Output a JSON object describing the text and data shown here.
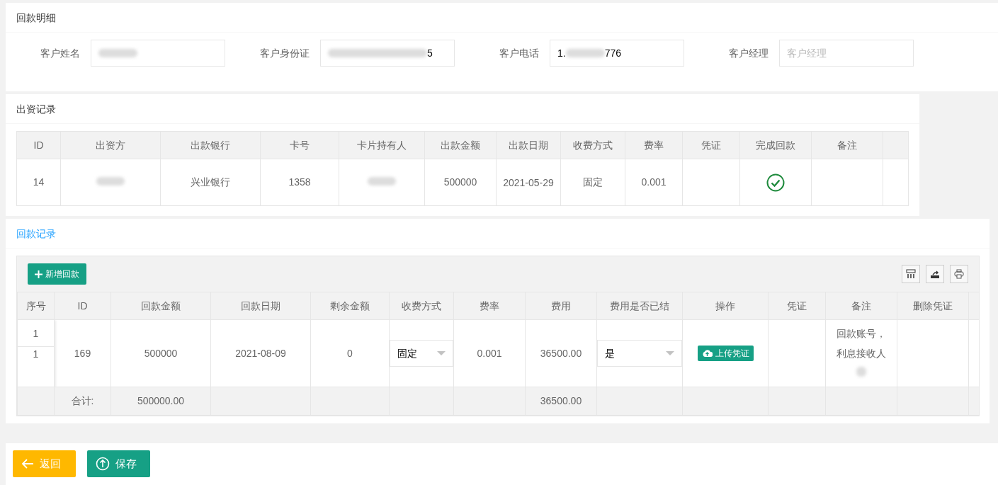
{
  "customer_panel": {
    "title": "回款明细",
    "fields": [
      {
        "label": "客户姓名",
        "redacted": true
      },
      {
        "label": "客户身份证",
        "redacted": true,
        "value_end": "5"
      },
      {
        "label": "客户电话",
        "redacted": true,
        "value_start": "1.",
        "value_end": "776"
      },
      {
        "label": "客户经理",
        "placeholder": "客户经理"
      }
    ]
  },
  "funding_panel": {
    "title": "出资记录",
    "columns": [
      "ID",
      "出资方",
      "出款银行",
      "卡号",
      "卡片持有人",
      "出款金额",
      "出款日期",
      "收费方式",
      "费率",
      "凭证",
      "完成回款",
      "备注"
    ],
    "rows": [
      {
        "id": "14",
        "funder_redacted": true,
        "bank": "兴业银行",
        "card": "1358",
        "holder_redacted": true,
        "amount": "500000",
        "date": "2021-05-29",
        "fee_mode": "固定",
        "rate": "0.001",
        "completed": true
      }
    ]
  },
  "repayment_panel": {
    "title": "回款记录",
    "add_button": "新增回款",
    "columns": [
      "序号",
      "ID",
      "回款金额",
      "回款日期",
      "剩余金额",
      "收费方式",
      "费率",
      "费用",
      "费用是否已结",
      "操作",
      "凭证",
      "备注",
      "删除凭证"
    ],
    "rows": [
      {
        "seq_fixed": "1",
        "seq": "1",
        "id": "169",
        "amount": "500000",
        "date": "2021-08-09",
        "remaining": "0",
        "fee_mode": "固定",
        "rate": "0.001",
        "fee": "36500.00",
        "settled": "是",
        "action": "上传凭证",
        "remark_lines": [
          "回款账号，",
          "利息接收人"
        ],
        "remark_redacted": true
      }
    ],
    "totals": {
      "label": "合计:",
      "amount": "500000.00",
      "fee": "36500.00"
    }
  },
  "footer": {
    "back_button": "返回",
    "save_button": "保存"
  }
}
